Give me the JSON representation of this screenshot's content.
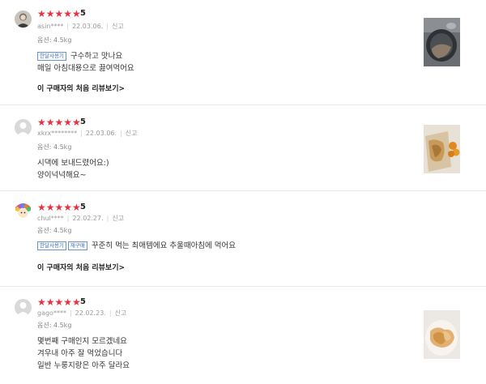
{
  "reviews": [
    {
      "stars": "★★★★★",
      "score": "5",
      "user": "asin****",
      "date": "22.03.06.",
      "report": "신고",
      "option": "옵션: 4.5kg",
      "badges": [
        "한달사용기"
      ],
      "lines": [
        "구수하고 맛나요",
        "매일 아침대용으로 끓여먹어요"
      ],
      "first_review_link": "이 구매자의 처음 리뷰보기>",
      "avatar": "profile-photo",
      "photo": "review-photo-pot"
    },
    {
      "stars": "★★★★★",
      "score": "5",
      "user": "xkrx********",
      "date": "22.03.06.",
      "report": "신고",
      "option": "옵션: 4.5kg",
      "badges": [],
      "lines": [
        "시댁에 보내드렸어요:)",
        "양이넉넉해요~"
      ],
      "first_review_link": "",
      "avatar": "default-avatar",
      "photo": "review-photo-snack-bag"
    },
    {
      "stars": "★★★★★",
      "score": "5",
      "user": "chul****",
      "date": "22.02.27.",
      "report": "신고",
      "option": "옵션: 4.5kg",
      "badges": [
        "한달사용기",
        "재구매"
      ],
      "lines": [
        "꾸준히 먹는 최애템에요 추울때아침에 먹어요"
      ],
      "first_review_link": "이 구매자의 처음 리뷰보기>",
      "avatar": "rainbow-character-avatar",
      "photo": ""
    },
    {
      "stars": "★★★★★",
      "score": "5",
      "user": "gago****",
      "date": "22.02.23.",
      "report": "신고",
      "option": "옵션: 4.5kg",
      "badges": [],
      "lines": [
        "몇번째 구매인지 모르겠네요",
        "겨우내 아주 잘 먹었습니다",
        "일반 누룽지랑은 아주 달라요"
      ],
      "first_review_link": "",
      "avatar": "default-avatar",
      "photo": "review-photo-nurungji"
    }
  ],
  "colors": {
    "star": "#e8313f",
    "badge_border": "#6f95c7",
    "divider": "#e6e6e6"
  }
}
